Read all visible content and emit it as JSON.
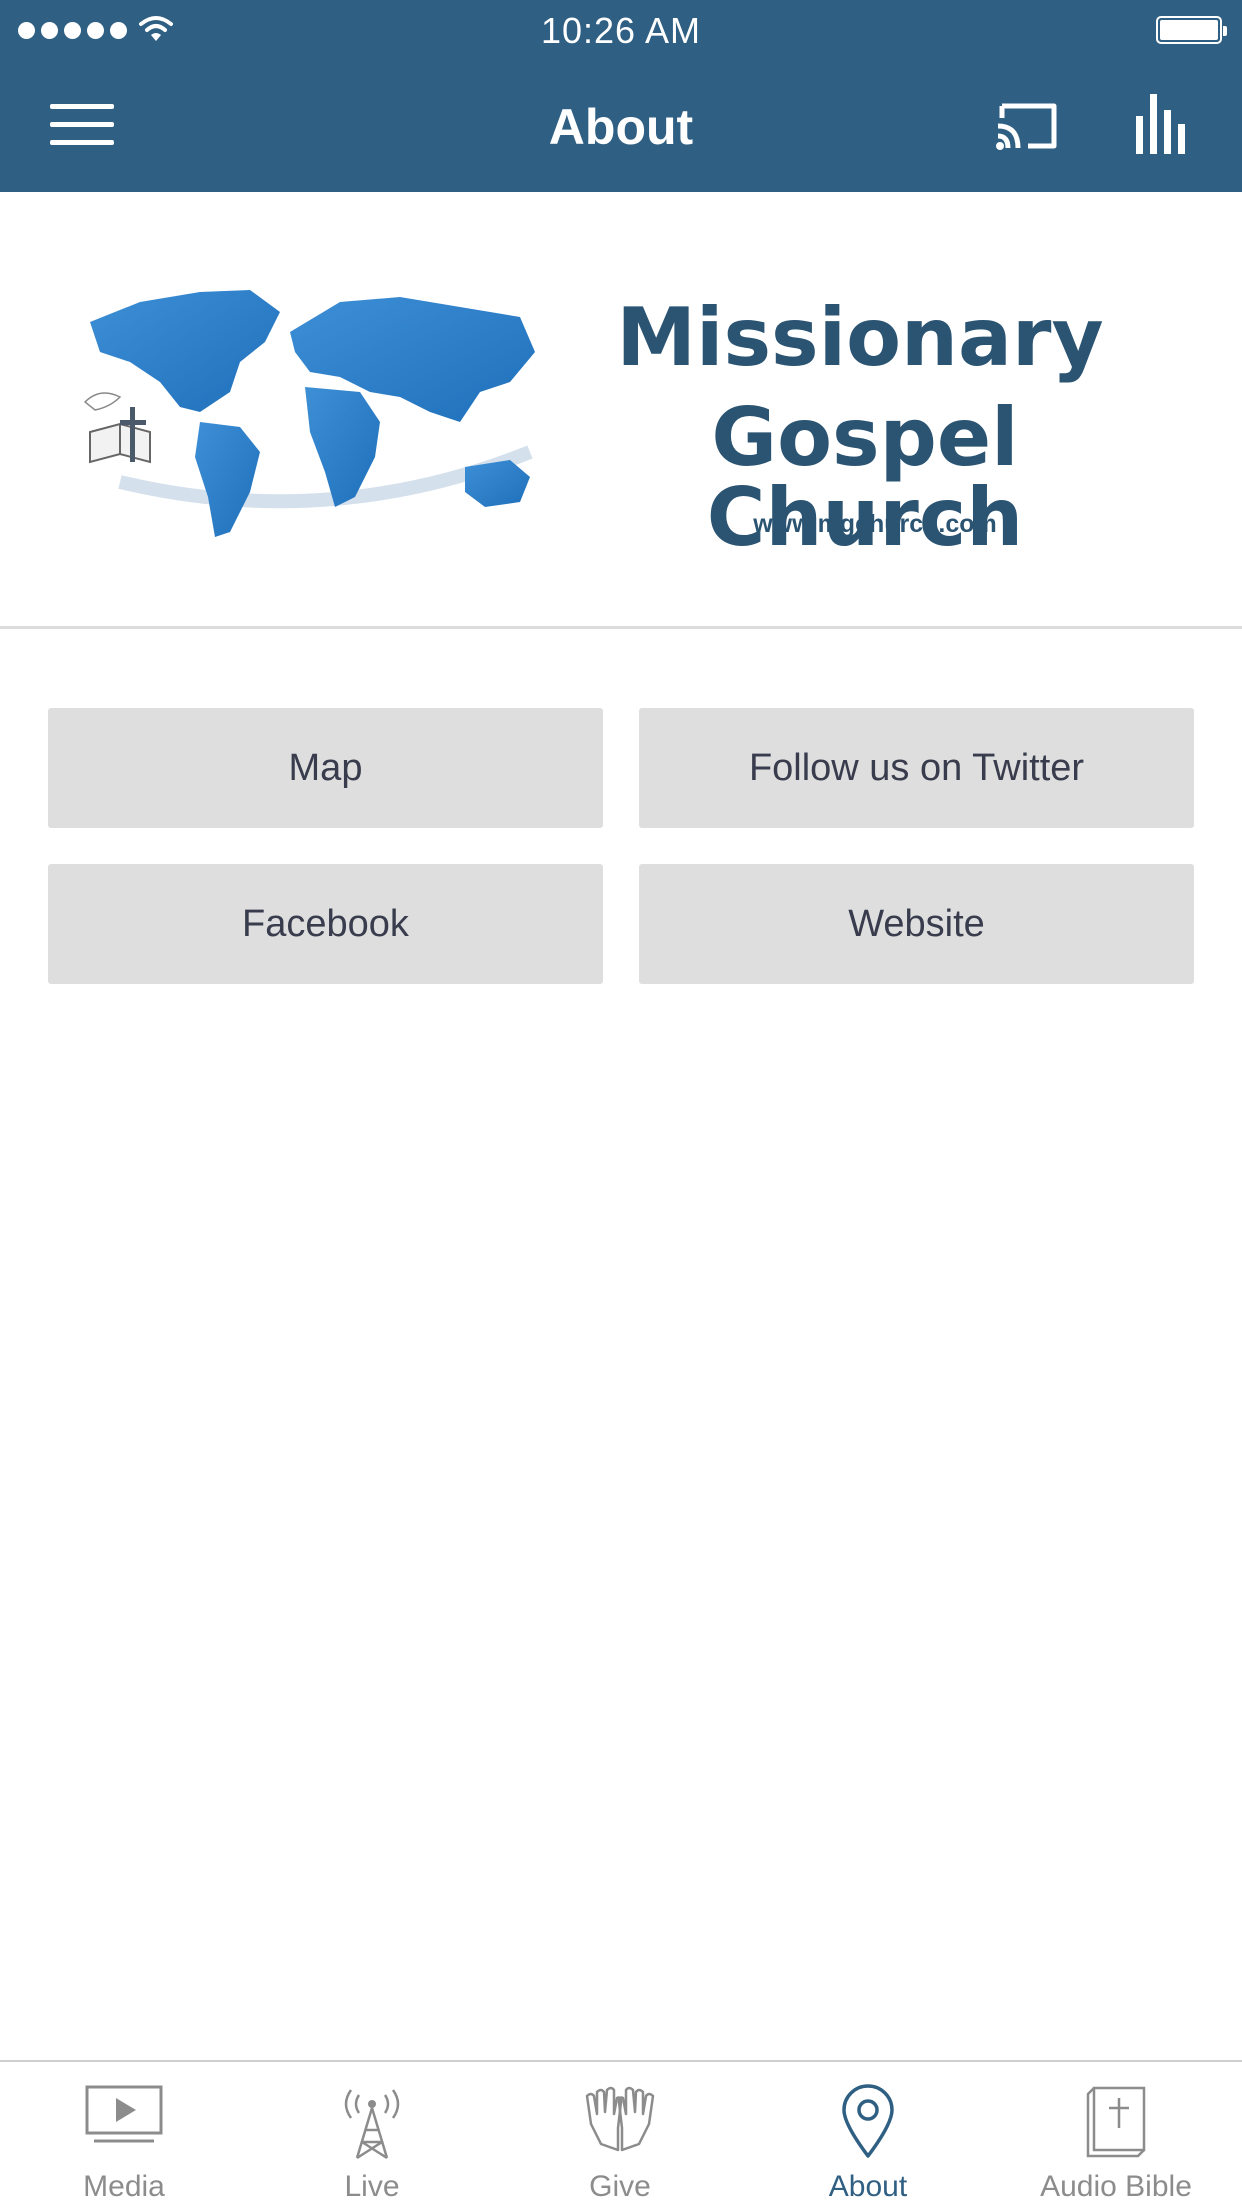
{
  "status_bar": {
    "time": "10:26 AM"
  },
  "nav": {
    "title": "About"
  },
  "logo": {
    "line1": "Missionary",
    "line2": "Gospel Church",
    "url": "www.mgchurch.com"
  },
  "buttons": {
    "map": "Map",
    "twitter": "Follow us on Twitter",
    "facebook": "Facebook",
    "website": "Website"
  },
  "tabs": [
    {
      "label": "Media",
      "icon": "media-icon"
    },
    {
      "label": "Live",
      "icon": "live-tower-icon"
    },
    {
      "label": "Give",
      "icon": "give-hands-icon"
    },
    {
      "label": "About",
      "icon": "location-pin-icon",
      "active": true
    },
    {
      "label": "Audio Bible",
      "icon": "bible-icon"
    }
  ],
  "colors": {
    "header": "#2f5f82",
    "button_bg": "#dedede",
    "button_text": "#383c4d",
    "tab_inactive": "#8c8c8c",
    "tab_active": "#2f5f82",
    "brand_text": "#2b5473"
  }
}
